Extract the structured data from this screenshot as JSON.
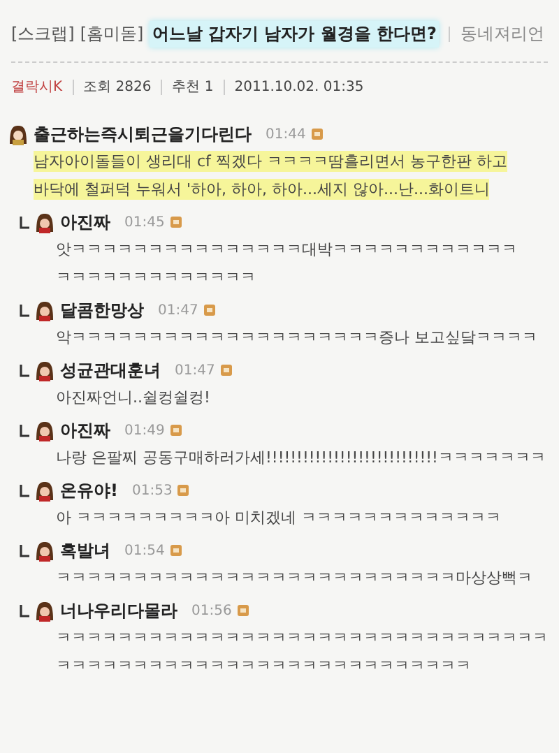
{
  "post": {
    "tags": [
      "[스크랩]",
      "[홈미돋]"
    ],
    "title": "어느날 갑자기 남자가 월경을 한다면?",
    "board": "동네져리언",
    "author": "결락시K",
    "views": "조회 2826",
    "likes": "추천 1",
    "date": "2011.10.02. 01:35"
  },
  "comments": [
    {
      "kind": "comment",
      "name": "출근하는즉시퇴근을기다린다",
      "time": "01:44",
      "lines": [
        "남자아이돌들이 생리대 cf 찍겠다 ㅋㅋㅋㅋ땀흘리면서 농구한판 하고",
        "바닥에 철퍼덕 누워서 '하아, 하아, 하아...세지 않아...난...화이트니"
      ]
    },
    {
      "kind": "reply",
      "name": "아진짜",
      "time": "01:45",
      "lines": [
        "앗ㅋㅋㅋㅋㅋㅋㅋㅋㅋㅋㅋㅋㅋㅋㅋ대박ㅋㅋㅋㅋㅋㅋㅋㅋㅋㅋㅋㅋ",
        "ㅋㅋㅋㅋㅋㅋㅋㅋㅋㅋㅋㅋㅋ"
      ]
    },
    {
      "kind": "reply",
      "name": "달콤한망상",
      "time": "01:47",
      "lines": [
        "악ㅋㅋㅋㅋㅋㅋㅋㅋㅋㅋㅋㅋㅋㅋㅋㅋㅋㅋㅋㅋ증나 보고싶닼ㅋㅋㅋㅋ"
      ]
    },
    {
      "kind": "reply",
      "name": "성균관대훈녀",
      "time": "01:47",
      "lines": [
        "아진짜언니..쉴컹쉴컹!"
      ]
    },
    {
      "kind": "reply",
      "name": "아진짜",
      "time": "01:49",
      "lines": [
        "나랑 은팔찌 공동구매하러가세!!!!!!!!!!!!!!!!!!!!!!!!!!!!ㅋㅋㅋㅋㅋㅋㅋ"
      ]
    },
    {
      "kind": "reply",
      "name": "온유야!",
      "time": "01:53",
      "lines": [
        "아 ㅋㅋㅋㅋㅋㅋㅋㅋㅋ아 미치겠네 ㅋㅋㅋㅋㅋㅋㅋㅋㅋㅋㅋㅋㅋ"
      ]
    },
    {
      "kind": "reply",
      "name": "흑발녀",
      "time": "01:54",
      "lines": [
        "ㅋㅋㅋㅋㅋㅋㅋㅋㅋㅋㅋㅋㅋㅋㅋㅋㅋㅋㅋㅋㅋㅋㅋㅋㅋㅋ마상상뻑ㅋ"
      ]
    },
    {
      "kind": "reply",
      "name": "너나우리다몰라",
      "time": "01:56",
      "lines": [
        "ㅋㅋㅋㅋㅋㅋㅋㅋㅋㅋㅋㅋㅋㅋㅋㅋㅋㅋㅋㅋㅋㅋㅋㅋㅋㅋㅋㅋㅋㅋㅋㅋ",
        "ㅋㅋㅋㅋㅋㅋㅋㅋㅋㅋㅋㅋㅋㅋㅋㅋㅋㅋㅋㅋㅋㅋㅋㅋㅋㅋㅋ"
      ]
    }
  ]
}
